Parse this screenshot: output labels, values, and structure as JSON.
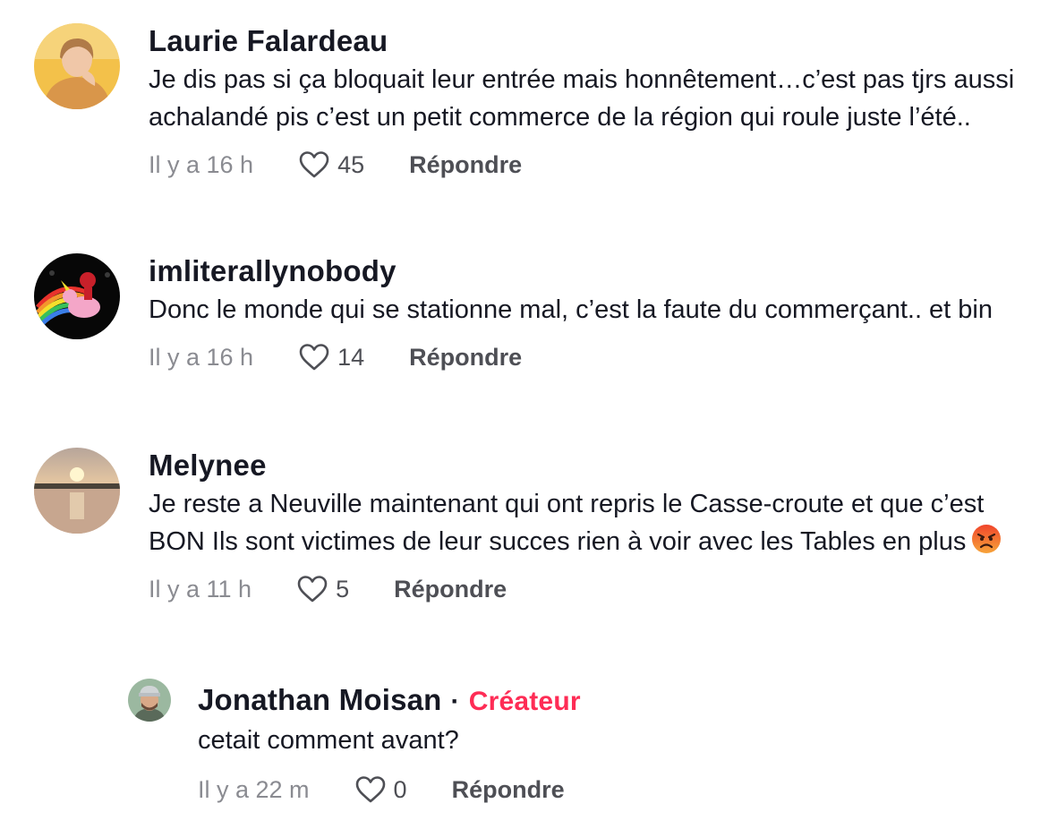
{
  "comments": [
    {
      "username": "Laurie Falardeau",
      "text": "Je dis pas si ça bloquait leur entrée mais honnêtement…c’est pas tjrs aussi achalandé pis c’est un petit commerce de la région qui roule juste l’été..",
      "time": "Il y a 16 h",
      "likes": "45",
      "reply_label": "Répondre",
      "avatar_icon": "avatar-woman-yellow-sweater"
    },
    {
      "username": "imliterallynobody",
      "text": "Donc le monde qui se stationne mal, c’est la faute du commerçant.. et bin",
      "time": "Il y a 16 h",
      "likes": "14",
      "reply_label": "Répondre",
      "avatar_icon": "avatar-unicorn-rainbow"
    },
    {
      "username": "Melynee",
      "text": "Je reste a Neuville maintenant qui ont repris le Casse-croute et que c’est BON Ils sont victimes de leur succes rien à voir avec les Tables en plus",
      "emoji": "angry-face-emoji",
      "time": "Il y a 11 h",
      "likes": "5",
      "reply_label": "Répondre",
      "avatar_icon": "avatar-sunset-lake"
    }
  ],
  "reply": {
    "username": "Jonathan Moisan",
    "separator": "·",
    "badge": "Créateur",
    "text": "cetait comment avant?",
    "time": "Il y a 22 m",
    "likes": "0",
    "reply_label": "Répondre",
    "avatar_icon": "avatar-man-cap"
  },
  "colors": {
    "text": "#161823",
    "muted": "#8a8b91",
    "secondary": "#4e4f55",
    "creator_badge": "#fe2c55"
  }
}
